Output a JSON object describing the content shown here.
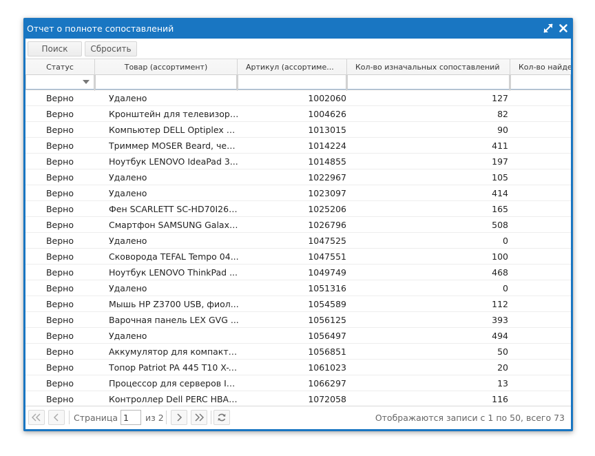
{
  "window": {
    "title": "Отчет о полноте сопоставлений"
  },
  "toolbar": {
    "search_label": "Поиск",
    "reset_label": "Сбросить"
  },
  "columns": [
    {
      "label": "Статус"
    },
    {
      "label": "Товар (ассортимент)"
    },
    {
      "label": "Артикул (ассортиме..."
    },
    {
      "label": "Кол-во изначальных сопоставлений"
    },
    {
      "label": "Кол-во найден"
    }
  ],
  "rows": [
    {
      "status": "Верно",
      "name": "Удалено",
      "article": "1002060",
      "qty": "127"
    },
    {
      "status": "Верно",
      "name": "Кронштейн для телевизора...",
      "article": "1004626",
      "qty": "82"
    },
    {
      "status": "Верно",
      "name": "Компьютер DELL Optiplex 7...",
      "article": "1013015",
      "qty": "90"
    },
    {
      "status": "Верно",
      "name": "Триммер MOSER Beard, чер...",
      "article": "1014224",
      "qty": "411"
    },
    {
      "status": "Верно",
      "name": "Ноутбук LENOVO IdeaPad 3...",
      "article": "1014855",
      "qty": "197"
    },
    {
      "status": "Верно",
      "name": "Удалено",
      "article": "1022967",
      "qty": "105"
    },
    {
      "status": "Верно",
      "name": "Удалено",
      "article": "1023097",
      "qty": "414"
    },
    {
      "status": "Верно",
      "name": "Фен SCARLETT SC-HD70I26, ...",
      "article": "1025206",
      "qty": "165"
    },
    {
      "status": "Верно",
      "name": "Смартфон SAMSUNG Galaxy...",
      "article": "1026796",
      "qty": "508"
    },
    {
      "status": "Верно",
      "name": "Удалено",
      "article": "1047525",
      "qty": "0"
    },
    {
      "status": "Верно",
      "name": "Сковорода TEFAL Tempo 04...",
      "article": "1047551",
      "qty": "100"
    },
    {
      "status": "Верно",
      "name": "Ноутбук LENOVO ThinkPad ...",
      "article": "1049749",
      "qty": "468"
    },
    {
      "status": "Верно",
      "name": "Удалено",
      "article": "1051316",
      "qty": "0"
    },
    {
      "status": "Верно",
      "name": "Мышь HP Z3700 USB, фиол...",
      "article": "1054589",
      "qty": "112"
    },
    {
      "status": "Верно",
      "name": "Варочная панель LEX GVG ...",
      "article": "1056125",
      "qty": "393"
    },
    {
      "status": "Верно",
      "name": "Удалено",
      "article": "1056497",
      "qty": "494"
    },
    {
      "status": "Верно",
      "name": "Аккумулятор для компактн...",
      "article": "1056851",
      "qty": "50"
    },
    {
      "status": "Верно",
      "name": "Топор Patriot PA 445 T10 X-T...",
      "article": "1061023",
      "qty": "20"
    },
    {
      "status": "Верно",
      "name": "Процессор для серверов IN...",
      "article": "1066297",
      "qty": "13"
    },
    {
      "status": "Верно",
      "name": "Контроллер Dell PERC HBA3...",
      "article": "1072058",
      "qty": "116"
    }
  ],
  "pager": {
    "page_label": "Страница",
    "current_page": "1",
    "of_label": "из 2",
    "summary": "Отображаются записи с 1 по 50, всего 73"
  },
  "colors": {
    "accent": "#1976c2"
  }
}
